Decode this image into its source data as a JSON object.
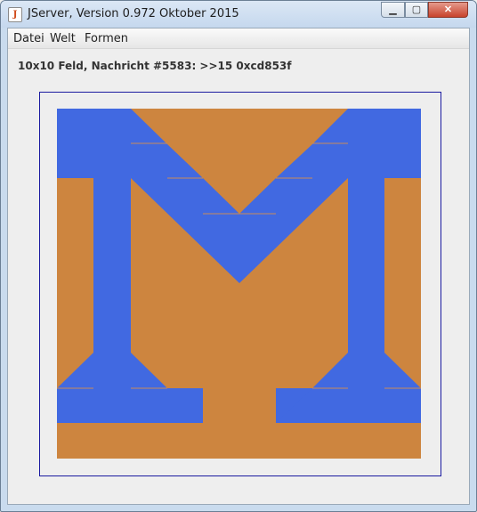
{
  "window": {
    "title": "JServer, Version 0.972 Oktober 2015",
    "icon": "java-app-icon",
    "controls": {
      "minimize": "▁",
      "maximize": "▢",
      "close": "✕"
    }
  },
  "menu": {
    "items": [
      "Datei",
      "Welt",
      "Formen"
    ]
  },
  "status": {
    "text": "10x10 Feld, Nachricht #5583: >>15 0xcd853f"
  },
  "board": {
    "grid": "10x10",
    "colors": {
      "background": "#cd853f",
      "foreground": "#4169e1",
      "frame": "#1a1aa0"
    }
  }
}
